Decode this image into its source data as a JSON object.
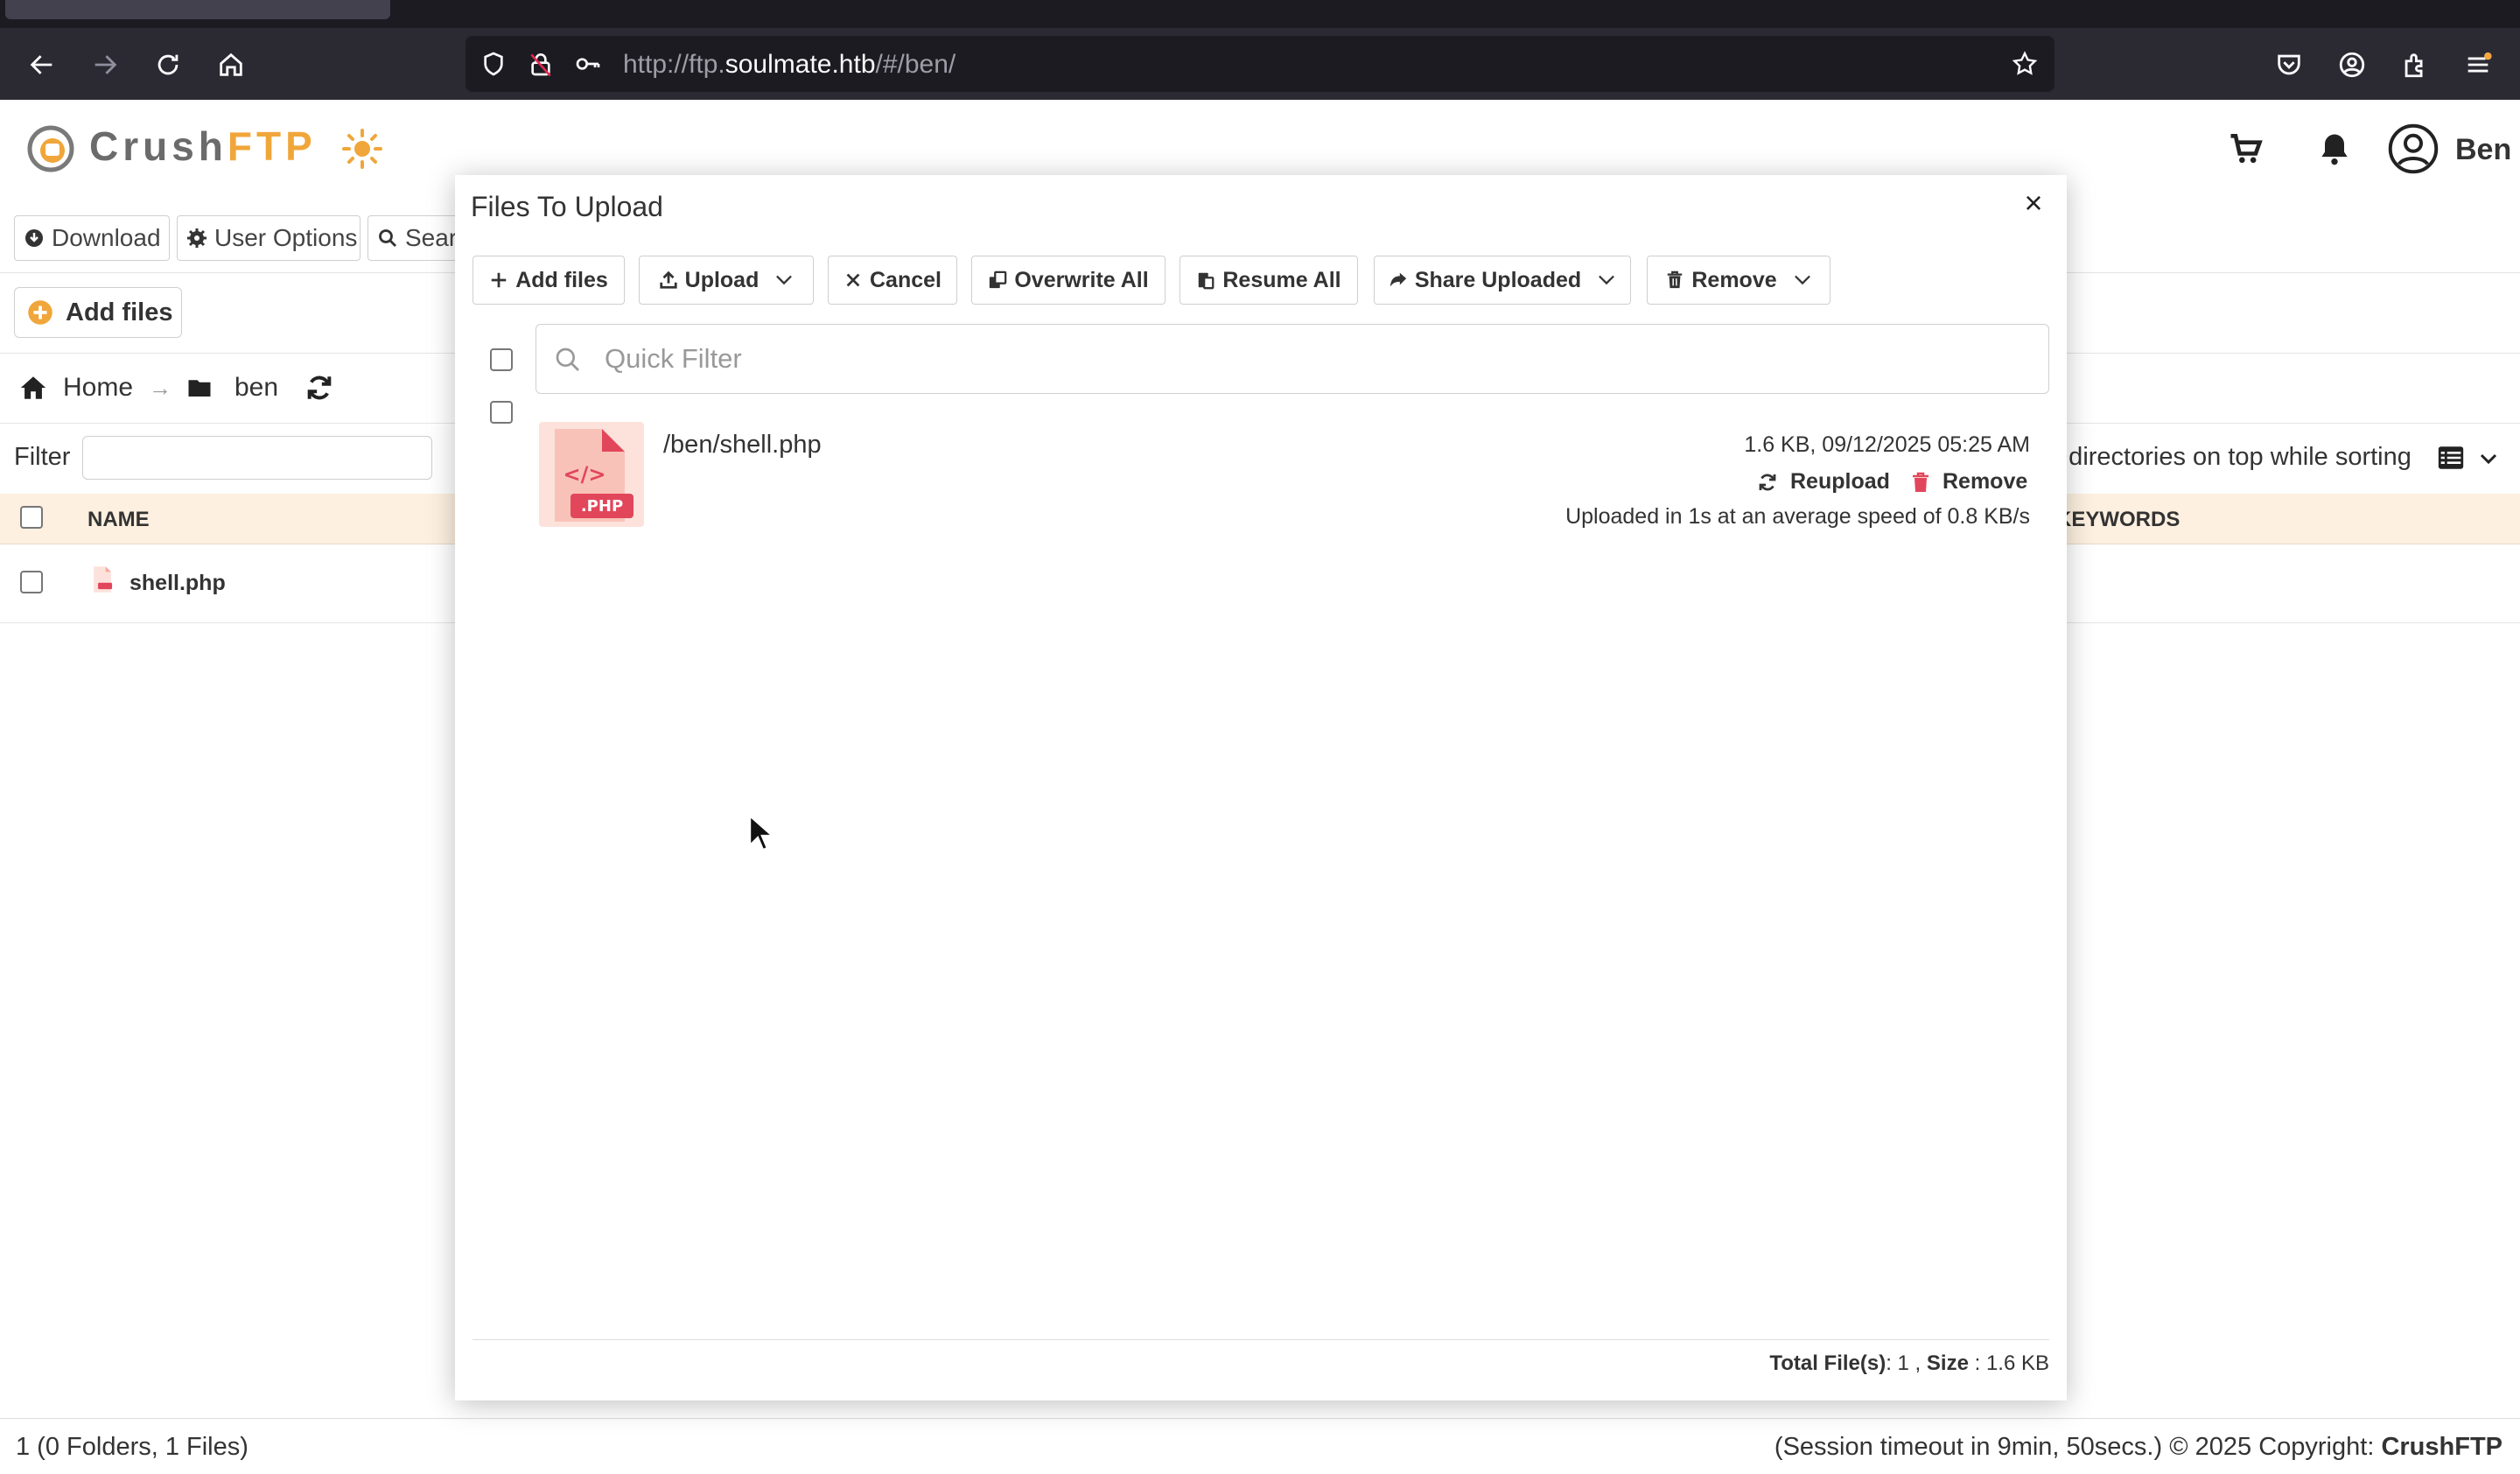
{
  "browser": {
    "url_prefix": "http://ftp.",
    "url_host": "soulmate.htb",
    "url_suffix": "/#/ben/"
  },
  "header": {
    "logo_crush": "Crush",
    "logo_ftp": "FTP",
    "user_name": "Ben",
    "accent_color": "#f0a63a"
  },
  "toolbar": {
    "download_label": "Download",
    "user_options_label": "User Options",
    "search_label": "Sear"
  },
  "add_files_label": "Add files",
  "breadcrumb": {
    "home": "Home",
    "separator": "→",
    "folder": "ben"
  },
  "filter": {
    "label": "Filter",
    "value": "",
    "dirs_on_top": "o directories on top while sorting"
  },
  "table": {
    "headers": {
      "name": "NAME",
      "keywords": "KEYWORDS"
    },
    "rows": [
      {
        "name": "shell.php"
      }
    ]
  },
  "status": {
    "left": "1 (0 Folders, 1 Files)",
    "right_prefix": "(Session timeout in 9min, 50secs.) © 2025 Copyright: ",
    "right_brand": "CrushFTP"
  },
  "modal": {
    "title": "Files To Upload",
    "close": "×",
    "buttons": {
      "add_files": "Add files",
      "upload": "Upload",
      "cancel": "Cancel",
      "overwrite_all": "Overwrite All",
      "resume_all": "Resume All",
      "share_uploaded": "Share Uploaded",
      "remove": "Remove"
    },
    "quick_filter_placeholder": "Quick Filter",
    "upload_item": {
      "path": "/ben/shell.php",
      "meta": "1.6 KB, 09/12/2025 05:25 AM",
      "reupload": "Reupload",
      "remove": "Remove",
      "speed": "Uploaded in 1s at an average speed of 0.8 KB/s",
      "thumb_code": "</>",
      "thumb_ext": ".PHP"
    },
    "footer": {
      "total_label": "Total File(s)",
      "total_value": ": 1 ,",
      "size_label": "Size",
      "size_value": ": 1.6 KB"
    }
  }
}
